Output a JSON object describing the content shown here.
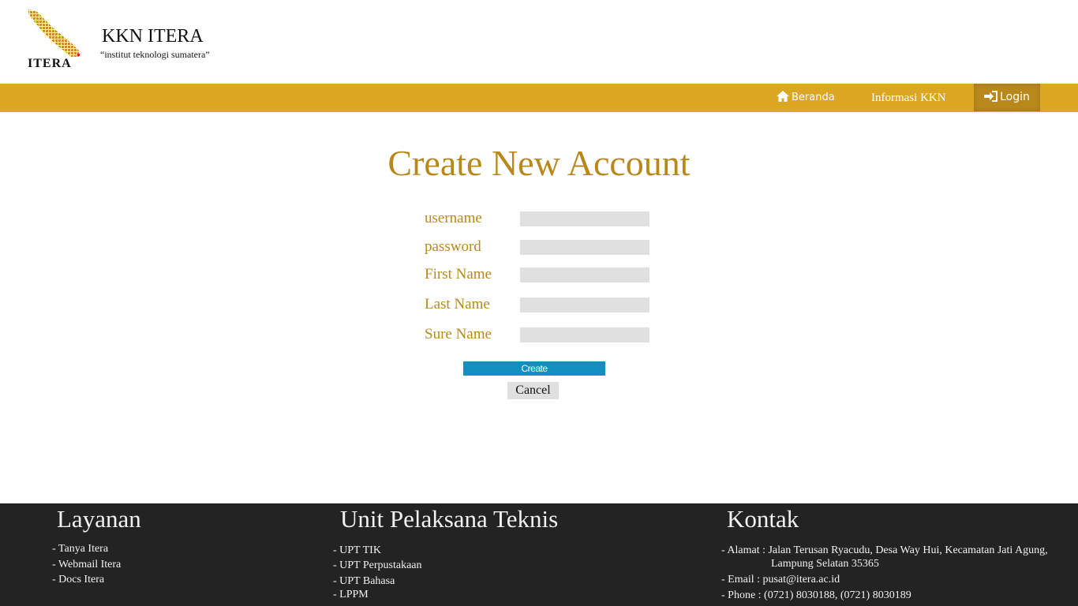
{
  "header": {
    "logo_text": "ITERA",
    "title": "KKN ITERA",
    "tagline": "“institut teknologi sumatera”"
  },
  "nav": {
    "home": "Beranda",
    "info": "Informasi KKN",
    "login": "Login"
  },
  "main": {
    "title": "Create New Account",
    "fields": [
      {
        "label": "username",
        "value": ""
      },
      {
        "label": "password",
        "value": ""
      },
      {
        "label": "First Name",
        "value": ""
      },
      {
        "label": "Last Name",
        "value": ""
      },
      {
        "label": "Sure Name",
        "value": ""
      }
    ],
    "create_label": "Create",
    "cancel_label": "Cancel"
  },
  "footer": {
    "layanan": {
      "heading": "Layanan",
      "items": [
        "- Tanya Itera",
        "- Webmail Itera",
        "- Docs Itera"
      ]
    },
    "upt": {
      "heading": "Unit Pelaksana Teknis",
      "items": [
        "- UPT TIK",
        "- UPT Perpustakaan",
        "- UPT Bahasa",
        "- LPPM"
      ]
    },
    "kontak": {
      "heading": "Kontak",
      "alamat_line1": "- Alamat : Jalan Terusan Ryacudu, Desa Way Hui, Kecamatan Jati Agung,",
      "alamat_line2": "Lampung Selatan 35365",
      "email": "- Email : pusat@itera.ac.id",
      "phone": "- Phone : (0721) 8030188, (0721) 8030189"
    }
  },
  "colors": {
    "nav_bg": "#dba621",
    "accent_gold": "#b8891a",
    "create_button": "#128fbf",
    "footer_bg": "#232323"
  }
}
